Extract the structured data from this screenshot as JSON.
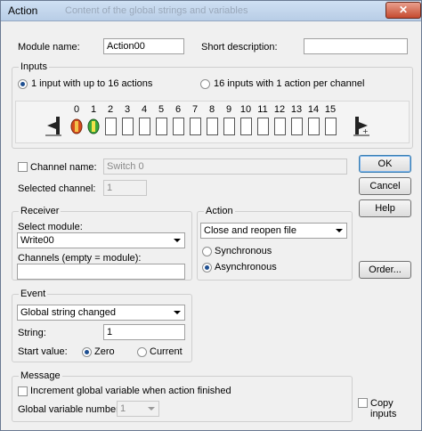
{
  "window": {
    "title": "Action",
    "ghost_text": "Content of the global strings and variables"
  },
  "module_name": {
    "label": "Module name:",
    "value": "Action00"
  },
  "short_description": {
    "label": "Short description:",
    "value": ""
  },
  "inputs": {
    "label": "Inputs",
    "option1": "1 input with up to 16 actions",
    "option2": "16 inputs with 1 action per channel",
    "selected": "option1",
    "channels": [
      "0",
      "1",
      "2",
      "3",
      "4",
      "5",
      "6",
      "7",
      "8",
      "9",
      "10",
      "11",
      "12",
      "13",
      "14",
      "15"
    ]
  },
  "channel_name": {
    "label": "Channel name:",
    "value": "Switch 0"
  },
  "selected_channel": {
    "label": "Selected channel:",
    "value": "1"
  },
  "receiver": {
    "label": "Receiver",
    "select_module_label": "Select module:",
    "module_value": "Write00",
    "channels_label": "Channels (empty = module):",
    "channels_value": ""
  },
  "action": {
    "label": "Action",
    "value": "Close and reopen file",
    "sync": "Synchronous",
    "async": "Asynchronous",
    "selected": "async"
  },
  "event": {
    "label": "Event",
    "value": "Global string changed",
    "string_label": "String:",
    "string_value": "1",
    "start_label": "Start value:",
    "zero": "Zero",
    "current": "Current",
    "selected": "zero"
  },
  "message": {
    "label": "Message",
    "increment": "Increment global variable when action finished",
    "gvar_label": "Global variable number:",
    "gvar_value": "1"
  },
  "buttons": {
    "ok": "OK",
    "cancel": "Cancel",
    "help": "Help",
    "order": "Order..."
  },
  "copy_inputs": "Copy inputs",
  "colors": {
    "led_red": "#d64a1c",
    "led_green": "#3aa83a",
    "accent": "#1e4f91"
  }
}
